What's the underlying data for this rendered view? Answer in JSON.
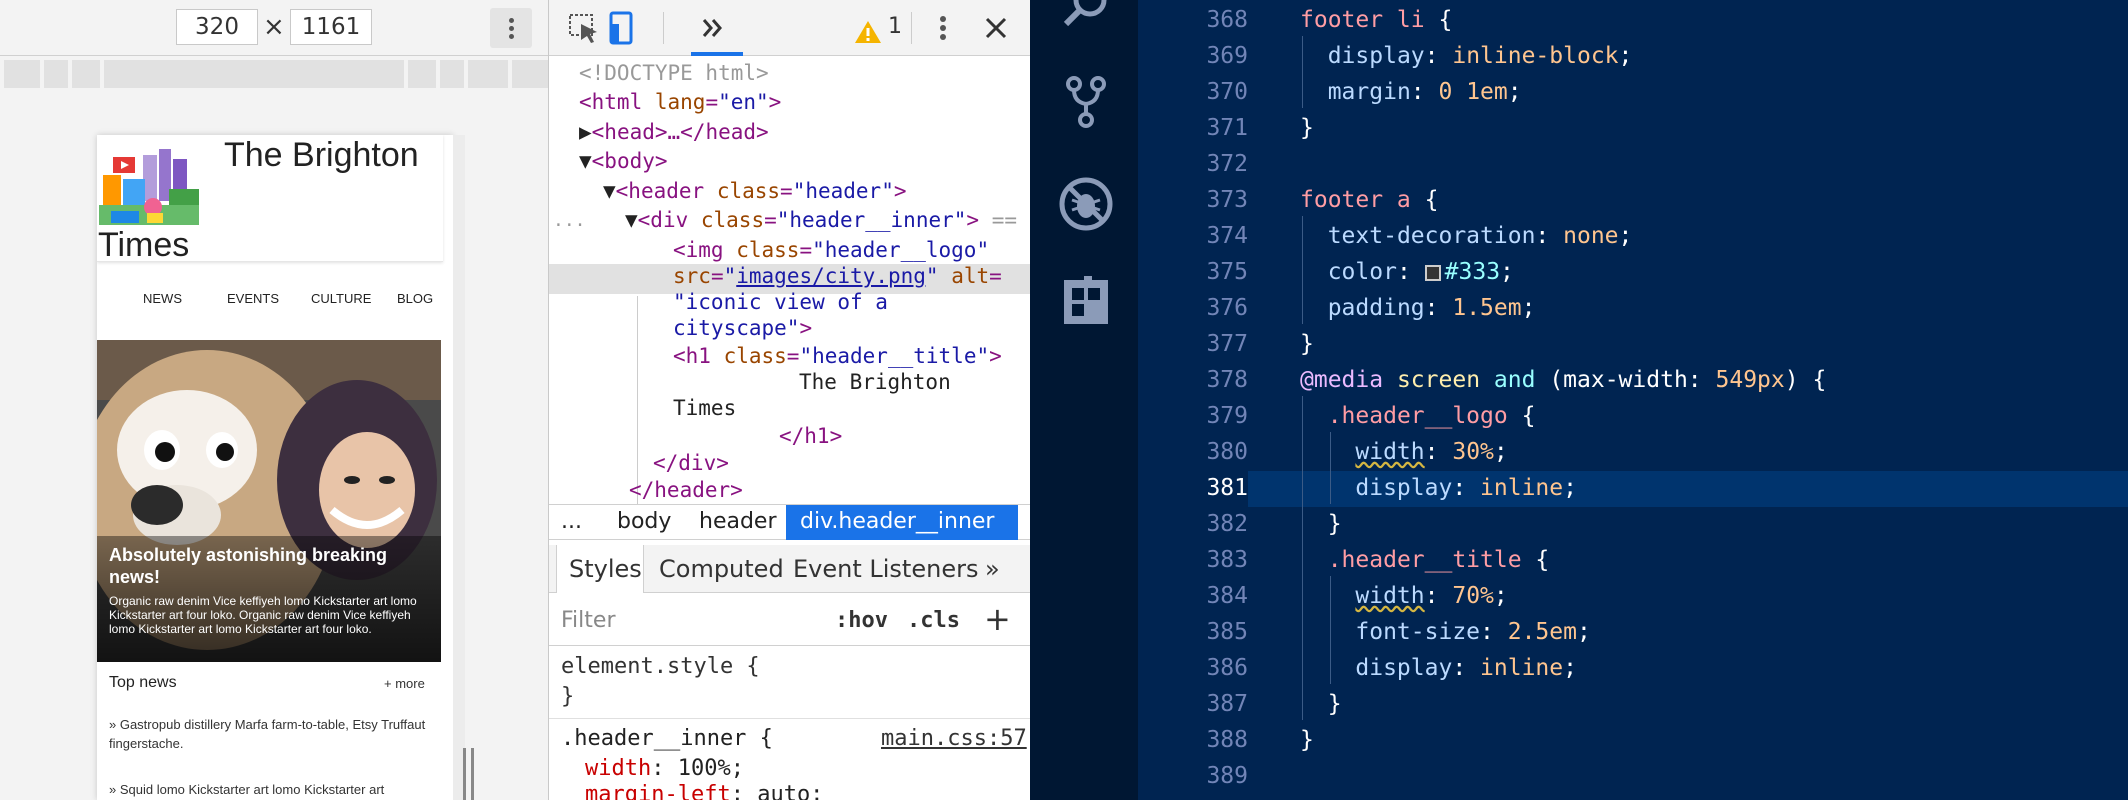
{
  "preview": {
    "width_value": "320",
    "height_value": "1161",
    "times_symbol": "×",
    "site": {
      "title_line1": "The Brighton",
      "title_line2": "Times",
      "logo_icon": "city-icon",
      "nav": [
        "NEWS",
        "EVENTS",
        "CULTURE",
        "BLOG"
      ],
      "hero_title": "Absolutely astonishing breaking news!",
      "hero_text": "Organic raw denim Vice keffiyeh lomo Kickstarter art lomo Kickstarter art four loko. Organic raw denim Vice keffiyeh lomo Kickstarter art lomo Kickstarter art four loko.",
      "top_news_label": "Top news",
      "more_link": "+ more",
      "news_items": [
        "»    Gastropub distillery Marfa farm-to-table, Etsy Truffaut fingerstache.",
        "»    Squid lomo Kickstarter art lomo Kickstarter art"
      ]
    }
  },
  "devtools": {
    "warning_count": "1",
    "dom_tree": {
      "doctype": "<!DOCTYPE html>",
      "html_open": "<html lang=\"en\">",
      "head": "<head>…</head>",
      "body": "<body>",
      "header": "<header class=\"header\">",
      "div": "<div class=\"header__inner\"> ==",
      "img_1": "<img class=\"header__logo\"",
      "img_2": "src=\"images/city.png\" alt=",
      "img_3": "\"iconic view of a",
      "img_4": "cityscape\">",
      "h1": "<h1 class=\"header__title\">",
      "h1_text_1": "The Brighton",
      "h1_text_2": "Times",
      "h1_close": "</h1>",
      "div_close": "</div>",
      "header_close": "</header>",
      "ellipsis": "..."
    },
    "breadcrumbs": [
      "...",
      "body",
      "header",
      "div.header__inner"
    ],
    "tabs": [
      "Styles",
      "Computed",
      "Event Listeners"
    ],
    "tabs_overflow": "»",
    "filter_placeholder": "Filter",
    "hov_label": ":hov",
    "cls_label": ".cls",
    "add_label": "+",
    "styles": {
      "element_style_open": "element.style {",
      "element_style_close": "}",
      "rule_selector": ".header__inner {",
      "rule_source": "main.css:57",
      "prop1_name": "width",
      "prop1_value": "100%;",
      "prop2_name": "margin-left",
      "prop2_value": "auto;"
    }
  },
  "editor": {
    "current_line": 381,
    "line_numbers": [
      "368",
      "369",
      "370",
      "371",
      "372",
      "373",
      "374",
      "375",
      "376",
      "377",
      "378",
      "379",
      "380",
      "381",
      "382",
      "383",
      "384",
      "385",
      "386",
      "387",
      "388",
      "389"
    ],
    "code": {
      "l368_sel": "footer li",
      "l368_brace": " {",
      "l369_prop": "display",
      "l369_val": "inline-block",
      "l370_prop": "margin",
      "l370_val": "0 1em",
      "close": "}",
      "l373_sel": "footer a",
      "l374_prop": "text-decoration",
      "l374_val": "none",
      "l375_prop": "color",
      "l375_val": "#333",
      "l376_prop": "padding",
      "l376_val": "1.5em",
      "l378_at": "@media",
      "l378_screen": "screen",
      "l378_and": "and",
      "l378_open": "(",
      "l378_feature": "max-width",
      "l378_value": "549px",
      "l378_close": ") {",
      "l379_sel": ".header__logo",
      "l380_prop": "width",
      "l380_val": "30%",
      "l381_prop": "display",
      "l381_val": "inline",
      "l383_sel": ".header__title",
      "l384_prop": "width",
      "l384_val": "70%",
      "l385_prop": "font-size",
      "l385_val": "2.5em",
      "l386_prop": "display",
      "l386_val": "inline"
    },
    "colors": {
      "background": "#002451",
      "activity_bar": "#001733",
      "current_line": "#00346e"
    },
    "activity_icons": [
      "search-icon",
      "source-control-icon",
      "debug-icon",
      "extensions-icon"
    ]
  },
  "devtools_icons": [
    "inspect-element-icon",
    "device-toolbar-icon",
    "more-tabs-icon",
    "warning-icon",
    "kebab-menu-icon",
    "close-icon"
  ]
}
